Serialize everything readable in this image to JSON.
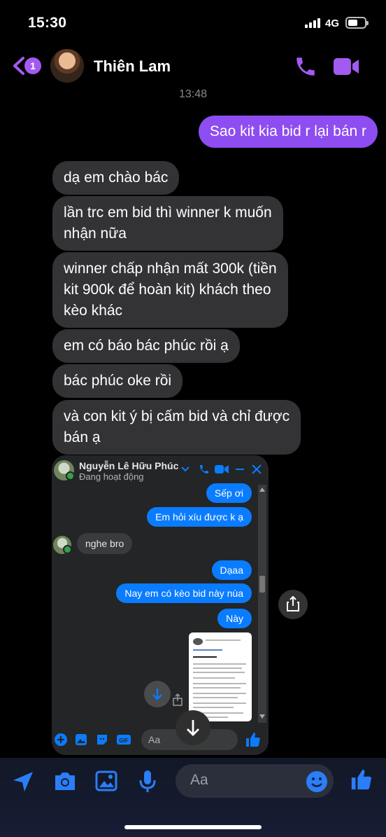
{
  "status_bar": {
    "time": "15:30",
    "network": "4G"
  },
  "header": {
    "badge": "1",
    "contact_name": "Thiên Lam"
  },
  "timestamp": "13:48",
  "outgoing": {
    "text": "Sao kit kia bid r lại bán r"
  },
  "incoming": [
    {
      "lines": [
        "dạ em chào bác"
      ]
    },
    {
      "lines": [
        "lần trc em bid thì winner k muốn",
        "nhận nữa"
      ]
    },
    {
      "lines": [
        "winner chấp nhận mất 300k (tiền",
        "kit 900k để hoàn kit) khách theo",
        "kèo khác"
      ]
    },
    {
      "lines": [
        "em có báo bác phúc rồi ạ"
      ]
    },
    {
      "lines": [
        "bác phúc oke rồi"
      ]
    },
    {
      "lines": [
        "và con kit ý bị cấm bid và chỉ được",
        "bán ạ"
      ]
    }
  ],
  "screenshot": {
    "name": "Nguyễn Lê Hữu Phúc",
    "status": "Đang hoạt động",
    "messages": [
      {
        "dir": "out",
        "text": "Sếp ơi"
      },
      {
        "dir": "out",
        "text": "Em hỏi xíu được k ạ"
      },
      {
        "dir": "in",
        "text": "nghe bro"
      },
      {
        "dir": "out",
        "text": "Dạaa"
      },
      {
        "dir": "out",
        "text": "Nay em có kèo bid này nùa"
      },
      {
        "dir": "out",
        "text": "Này"
      }
    ],
    "input_placeholder": "Aa"
  },
  "composer": {
    "placeholder": "Aa"
  },
  "colors": {
    "accent": "#8e4df0",
    "incoming_bubble": "#333335",
    "messenger_blue": "#0a7cff"
  }
}
